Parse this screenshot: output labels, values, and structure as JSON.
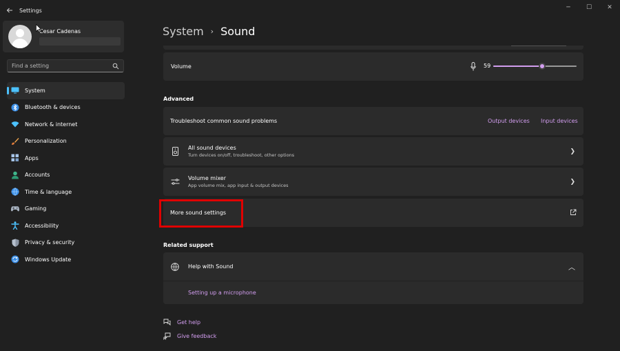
{
  "window": {
    "title": "Settings",
    "back_icon": "back-arrow-icon",
    "minimize_glyph": "─",
    "maximize_glyph": "☐",
    "close_glyph": "✕"
  },
  "profile": {
    "name": "Cesar Cadenas"
  },
  "search": {
    "placeholder": "Find a setting"
  },
  "sidebar": {
    "items": [
      {
        "label": "System",
        "icon": "monitor-icon",
        "active": true
      },
      {
        "label": "Bluetooth & devices",
        "icon": "bluetooth-icon"
      },
      {
        "label": "Network & internet",
        "icon": "wifi-icon"
      },
      {
        "label": "Personalization",
        "icon": "brush-icon"
      },
      {
        "label": "Apps",
        "icon": "apps-grid-icon"
      },
      {
        "label": "Accounts",
        "icon": "person-icon"
      },
      {
        "label": "Time & language",
        "icon": "globe-clock-icon"
      },
      {
        "label": "Gaming",
        "icon": "gamepad-icon"
      },
      {
        "label": "Accessibility",
        "icon": "accessibility-icon"
      },
      {
        "label": "Privacy & security",
        "icon": "shield-icon"
      },
      {
        "label": "Windows Update",
        "icon": "update-icon"
      }
    ]
  },
  "breadcrumb": {
    "parent": "System",
    "separator": "›",
    "current": "Sound"
  },
  "volume": {
    "label": "Volume",
    "value": "59",
    "level": 0.59
  },
  "advanced": {
    "heading": "Advanced",
    "troubleshoot": {
      "label": "Troubleshoot common sound problems",
      "link_output": "Output devices",
      "link_input": "Input devices"
    },
    "all_devices": {
      "label": "All sound devices",
      "sub": "Turn devices on/off, troubleshoot, other options"
    },
    "volume_mixer": {
      "label": "Volume mixer",
      "sub": "App volume mix, app input & output devices"
    },
    "more_settings": {
      "label": "More sound settings"
    }
  },
  "related": {
    "heading": "Related support",
    "help": {
      "label": "Help with Sound",
      "sub_link": "Setting up a microphone"
    }
  },
  "footer": {
    "get_help": "Get help",
    "give_feedback": "Give feedback"
  },
  "colors": {
    "accent": "#d39ef0",
    "nav_indicator": "#4cc2ff",
    "highlight": "#e00000"
  }
}
